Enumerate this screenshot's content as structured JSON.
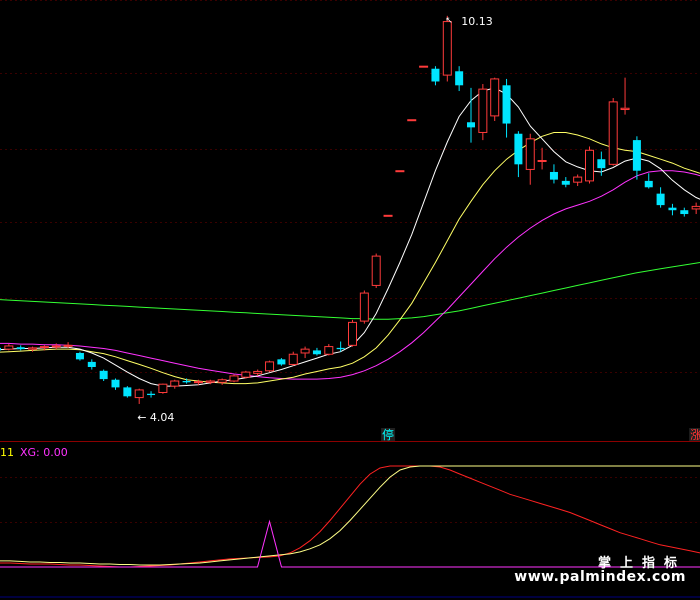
{
  "chart_data": [
    {
      "type": "candlestick",
      "title": "",
      "colors": {
        "up": "#ff3b3b",
        "down": "#00e5ff",
        "ma5": "#ffffff",
        "ma10": "#ffff66",
        "ma20": "#ff33ff",
        "ma60": "#33ff33"
      },
      "price_range": [
        3.6,
        10.3
      ],
      "annotations": {
        "high": "10.13",
        "low": "← 4.04",
        "high_mark": "↖"
      },
      "markers": [
        {
          "label": "停",
          "at": 33,
          "color": "#00ffff"
        },
        {
          "label": "涨",
          "at": 59,
          "color": "#ff3333"
        },
        {
          "label": "跌",
          "at": 60,
          "color": "#00ff66"
        }
      ],
      "ohlc": [
        [
          4.92,
          4.95,
          4.86,
          4.88
        ],
        [
          4.9,
          4.98,
          4.88,
          4.95
        ],
        [
          4.93,
          4.96,
          4.88,
          4.9
        ],
        [
          4.9,
          4.94,
          4.86,
          4.92
        ],
        [
          4.93,
          4.96,
          4.88,
          4.94
        ],
        [
          4.94,
          4.99,
          4.9,
          4.95
        ],
        [
          4.95,
          5.01,
          4.92,
          4.96
        ],
        [
          4.84,
          4.86,
          4.72,
          4.74
        ],
        [
          4.7,
          4.74,
          4.58,
          4.62
        ],
        [
          4.56,
          4.58,
          4.4,
          4.43
        ],
        [
          4.42,
          4.44,
          4.26,
          4.3
        ],
        [
          4.3,
          4.32,
          4.14,
          4.16
        ],
        [
          4.14,
          4.28,
          4.04,
          4.26
        ],
        [
          4.2,
          4.24,
          4.14,
          4.18
        ],
        [
          4.22,
          4.36,
          4.2,
          4.35
        ],
        [
          4.32,
          4.42,
          4.28,
          4.4
        ],
        [
          4.4,
          4.44,
          4.36,
          4.38
        ],
        [
          4.38,
          4.42,
          4.34,
          4.39
        ],
        [
          4.38,
          4.42,
          4.35,
          4.4
        ],
        [
          4.38,
          4.44,
          4.34,
          4.42
        ],
        [
          4.4,
          4.5,
          4.38,
          4.48
        ],
        [
          4.46,
          4.56,
          4.44,
          4.54
        ],
        [
          4.52,
          4.58,
          4.48,
          4.55
        ],
        [
          4.56,
          4.72,
          4.54,
          4.7
        ],
        [
          4.74,
          4.76,
          4.64,
          4.66
        ],
        [
          4.66,
          4.86,
          4.64,
          4.82
        ],
        [
          4.84,
          4.94,
          4.76,
          4.9
        ],
        [
          4.88,
          4.92,
          4.8,
          4.82
        ],
        [
          4.82,
          4.98,
          4.8,
          4.94
        ],
        [
          4.92,
          5.02,
          4.86,
          4.9
        ],
        [
          4.96,
          5.36,
          4.94,
          5.32
        ],
        [
          5.34,
          5.82,
          5.3,
          5.78
        ],
        [
          5.9,
          6.4,
          5.86,
          6.36
        ],
        [
          7.0,
          7.0,
          7.0,
          7.0
        ],
        [
          7.7,
          7.7,
          7.7,
          7.7
        ],
        [
          8.5,
          8.5,
          8.5,
          8.5
        ],
        [
          9.34,
          9.34,
          9.34,
          9.34
        ],
        [
          9.3,
          9.34,
          9.04,
          9.1
        ],
        [
          9.2,
          10.13,
          9.1,
          10.04
        ],
        [
          9.26,
          9.34,
          8.95,
          9.04
        ],
        [
          8.46,
          9.0,
          8.14,
          8.38
        ],
        [
          8.3,
          9.06,
          8.18,
          8.98
        ],
        [
          8.56,
          9.16,
          8.48,
          9.14
        ],
        [
          9.04,
          9.14,
          8.22,
          8.44
        ],
        [
          8.28,
          8.32,
          7.6,
          7.8
        ],
        [
          7.72,
          8.28,
          7.48,
          8.2
        ],
        [
          7.86,
          8.06,
          7.72,
          7.86
        ],
        [
          7.68,
          7.8,
          7.5,
          7.56
        ],
        [
          7.54,
          7.6,
          7.44,
          7.48
        ],
        [
          7.52,
          7.64,
          7.46,
          7.6
        ],
        [
          7.54,
          8.08,
          7.5,
          8.02
        ],
        [
          7.88,
          8.0,
          7.62,
          7.74
        ],
        [
          7.8,
          8.84,
          7.78,
          8.78
        ],
        [
          8.66,
          9.16,
          8.58,
          8.68
        ],
        [
          8.18,
          8.24,
          7.56,
          7.7
        ],
        [
          7.54,
          7.66,
          7.42,
          7.44
        ],
        [
          7.34,
          7.44,
          7.12,
          7.16
        ],
        [
          7.12,
          7.18,
          7.0,
          7.08
        ],
        [
          7.08,
          7.12,
          6.98,
          7.02
        ],
        [
          7.1,
          7.2,
          7.02,
          7.14
        ],
        [
          7.18,
          7.26,
          7.08,
          7.22
        ],
        [
          7.2,
          7.32,
          7.16,
          7.28
        ],
        [
          7.24,
          7.36,
          7.22,
          7.34
        ]
      ],
      "ma_lines": {
        "ma5": [
          4.89,
          4.9,
          4.91,
          4.91,
          4.92,
          4.93,
          4.93,
          4.9,
          4.84,
          4.76,
          4.65,
          4.54,
          4.44,
          4.36,
          4.32,
          4.32,
          4.33,
          4.34,
          4.37,
          4.4,
          4.42,
          4.45,
          4.48,
          4.53,
          4.58,
          4.64,
          4.7,
          4.76,
          4.82,
          4.86,
          4.96,
          5.16,
          5.46,
          5.85,
          6.26,
          6.7,
          7.2,
          7.7,
          8.15,
          8.55,
          8.8,
          8.95,
          9.0,
          8.9,
          8.7,
          8.4,
          8.2,
          8.0,
          7.84,
          7.76,
          7.7,
          7.68,
          7.75,
          7.85,
          7.9,
          7.85,
          7.73,
          7.55,
          7.4,
          7.28,
          7.2,
          7.18,
          7.2
        ],
        "ma10": [
          4.85,
          4.86,
          4.87,
          4.88,
          4.89,
          4.9,
          4.9,
          4.89,
          4.86,
          4.83,
          4.78,
          4.72,
          4.66,
          4.6,
          4.53,
          4.47,
          4.42,
          4.4,
          4.38,
          4.37,
          4.36,
          4.36,
          4.37,
          4.4,
          4.43,
          4.46,
          4.51,
          4.55,
          4.59,
          4.62,
          4.68,
          4.78,
          4.92,
          5.12,
          5.36,
          5.62,
          5.94,
          6.26,
          6.6,
          6.94,
          7.22,
          7.48,
          7.7,
          7.88,
          8.02,
          8.14,
          8.24,
          8.3,
          8.3,
          8.26,
          8.2,
          8.12,
          8.06,
          8.02,
          8.0,
          7.94,
          7.88,
          7.82,
          7.74,
          7.68,
          7.62,
          7.56,
          7.52
        ],
        "ma20": [
          4.99,
          4.99,
          4.98,
          4.98,
          4.97,
          4.97,
          4.96,
          4.95,
          4.93,
          4.91,
          4.88,
          4.84,
          4.8,
          4.76,
          4.72,
          4.68,
          4.64,
          4.6,
          4.57,
          4.54,
          4.51,
          4.49,
          4.47,
          4.45,
          4.44,
          4.43,
          4.43,
          4.43,
          4.44,
          4.46,
          4.5,
          4.56,
          4.64,
          4.74,
          4.86,
          5.0,
          5.16,
          5.34,
          5.52,
          5.72,
          5.92,
          6.12,
          6.32,
          6.5,
          6.66,
          6.8,
          6.92,
          7.02,
          7.1,
          7.16,
          7.22,
          7.3,
          7.4,
          7.52,
          7.62,
          7.68,
          7.7,
          7.7,
          7.68,
          7.64,
          7.58,
          7.52,
          7.46
        ],
        "ma60": [
          5.68,
          5.67,
          5.66,
          5.65,
          5.64,
          5.63,
          5.62,
          5.61,
          5.6,
          5.59,
          5.58,
          5.57,
          5.56,
          5.55,
          5.54,
          5.53,
          5.52,
          5.51,
          5.5,
          5.49,
          5.48,
          5.47,
          5.46,
          5.45,
          5.44,
          5.43,
          5.42,
          5.41,
          5.4,
          5.39,
          5.38,
          5.38,
          5.37,
          5.37,
          5.38,
          5.39,
          5.41,
          5.44,
          5.47,
          5.5,
          5.54,
          5.58,
          5.62,
          5.66,
          5.7,
          5.74,
          5.78,
          5.82,
          5.86,
          5.9,
          5.94,
          5.98,
          6.02,
          6.06,
          6.1,
          6.13,
          6.16,
          6.19,
          6.22,
          6.25,
          6.28,
          6.31,
          6.34
        ]
      }
    },
    {
      "type": "line",
      "title": "",
      "legend": [
        {
          "text": "11",
          "color": "#ffff00"
        },
        {
          "text": "XG: 0.00",
          "color": "#ff33ff"
        }
      ],
      "ylim": [
        0,
        100
      ],
      "series": [
        {
          "color": "#ff2222",
          "values": [
            4,
            4,
            3.5,
            3,
            3,
            3,
            2.5,
            2,
            2,
            1.5,
            1,
            0.5,
            0,
            0,
            0.5,
            1,
            1.5,
            2,
            3,
            4,
            5,
            6,
            7,
            8,
            8.5,
            9,
            9.5,
            10,
            11,
            14,
            19,
            26,
            35,
            46,
            58,
            70,
            82,
            92,
            98,
            100,
            100,
            100,
            100,
            100,
            99,
            96,
            92,
            88,
            84,
            80,
            76,
            72,
            69,
            66,
            63,
            60,
            57,
            54,
            50,
            46,
            42,
            38,
            34,
            31,
            28,
            25,
            22,
            20,
            18,
            16,
            14
          ]
        },
        {
          "color": "#ffff88",
          "values": [
            6,
            6,
            5.5,
            5,
            5,
            4.5,
            4.5,
            4,
            4,
            3.5,
            3,
            3,
            2.5,
            2.5,
            2,
            2,
            2,
            2.5,
            3,
            3.5,
            4,
            5,
            6,
            7,
            8,
            9,
            10,
            11,
            12,
            13,
            15,
            18,
            22,
            28,
            36,
            46,
            57,
            68,
            79,
            89,
            96,
            99,
            100,
            100,
            100,
            100,
            100,
            100,
            100,
            100,
            100,
            100,
            100,
            100,
            100,
            100,
            100,
            100,
            100,
            100,
            100,
            100,
            100,
            100,
            100,
            100,
            100,
            100,
            100,
            100,
            100
          ]
        },
        {
          "color": "#ff33ff",
          "values": [
            0,
            0,
            0,
            0,
            0,
            0,
            0,
            0,
            0,
            0,
            0,
            0,
            0,
            0,
            0,
            0,
            0,
            0,
            0,
            0,
            0,
            0,
            0,
            0,
            0,
            0,
            0,
            0,
            0,
            0,
            0,
            0,
            0,
            0,
            0,
            0,
            0,
            0,
            0,
            0,
            0,
            0,
            0,
            0,
            0,
            0,
            0,
            0,
            0,
            0,
            0,
            0,
            0,
            0,
            0,
            0,
            0,
            0,
            0,
            0,
            0,
            0,
            0,
            0,
            0,
            0,
            0,
            0,
            0,
            0,
            0
          ],
          "spike": {
            "at": 0.385,
            "value": 45
          }
        }
      ]
    }
  ],
  "watermark": {
    "cn": "掌上指标",
    "url": "www.palmindex.com"
  }
}
